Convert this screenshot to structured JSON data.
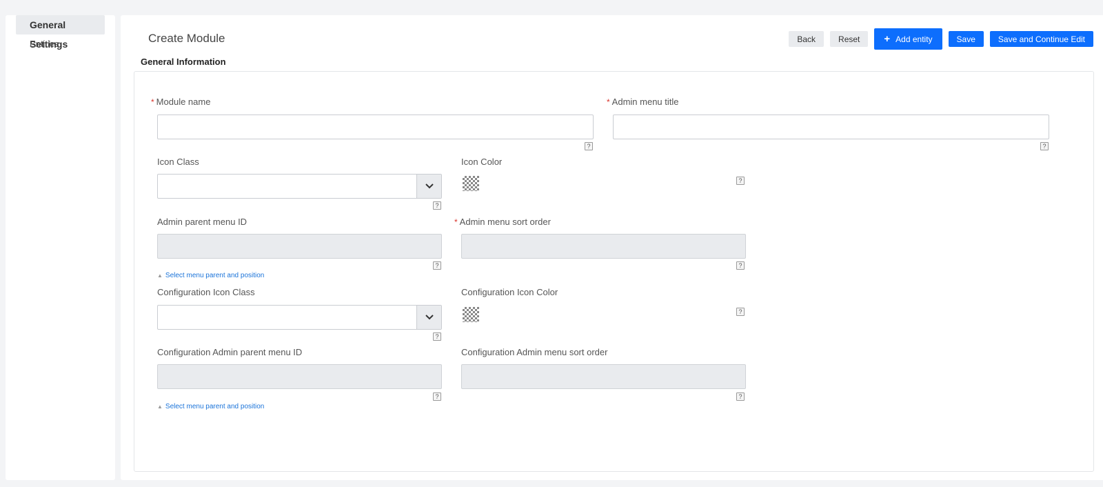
{
  "sidebar": {
    "items": [
      {
        "label": "General Settings"
      },
      {
        "label": "Entities"
      }
    ]
  },
  "header": {
    "title": "Create Module",
    "buttons": {
      "back": "Back",
      "reset": "Reset",
      "add_entity": "Add entity",
      "save": "Save",
      "save_continue": "Save and Continue Edit"
    }
  },
  "section": {
    "title": "General Information"
  },
  "form": {
    "required_mark": "*",
    "help_mark": "?",
    "module_name": {
      "label": "Module name",
      "value": ""
    },
    "admin_menu_title": {
      "label": "Admin menu title",
      "value": ""
    },
    "icon_class": {
      "label": "Icon Class",
      "value": ""
    },
    "icon_color": {
      "label": "Icon Color"
    },
    "admin_parent_menu_id": {
      "label": "Admin parent menu ID",
      "value": ""
    },
    "admin_menu_sort_order": {
      "label": "Admin menu sort order",
      "value": ""
    },
    "select_parent_link_1": "Select menu parent and position",
    "config_icon_class": {
      "label": "Configuration Icon Class",
      "value": ""
    },
    "config_icon_color": {
      "label": "Configuration Icon Color"
    },
    "config_admin_parent_menu_id": {
      "label": "Configuration Admin parent menu ID",
      "value": ""
    },
    "config_admin_menu_sort_order": {
      "label": "Configuration Admin menu sort order",
      "value": ""
    },
    "select_parent_link_2": "Select menu parent and position"
  },
  "colors": {
    "accent": "#0d6efd",
    "required": "#d9342b",
    "link": "#1a73d9"
  }
}
